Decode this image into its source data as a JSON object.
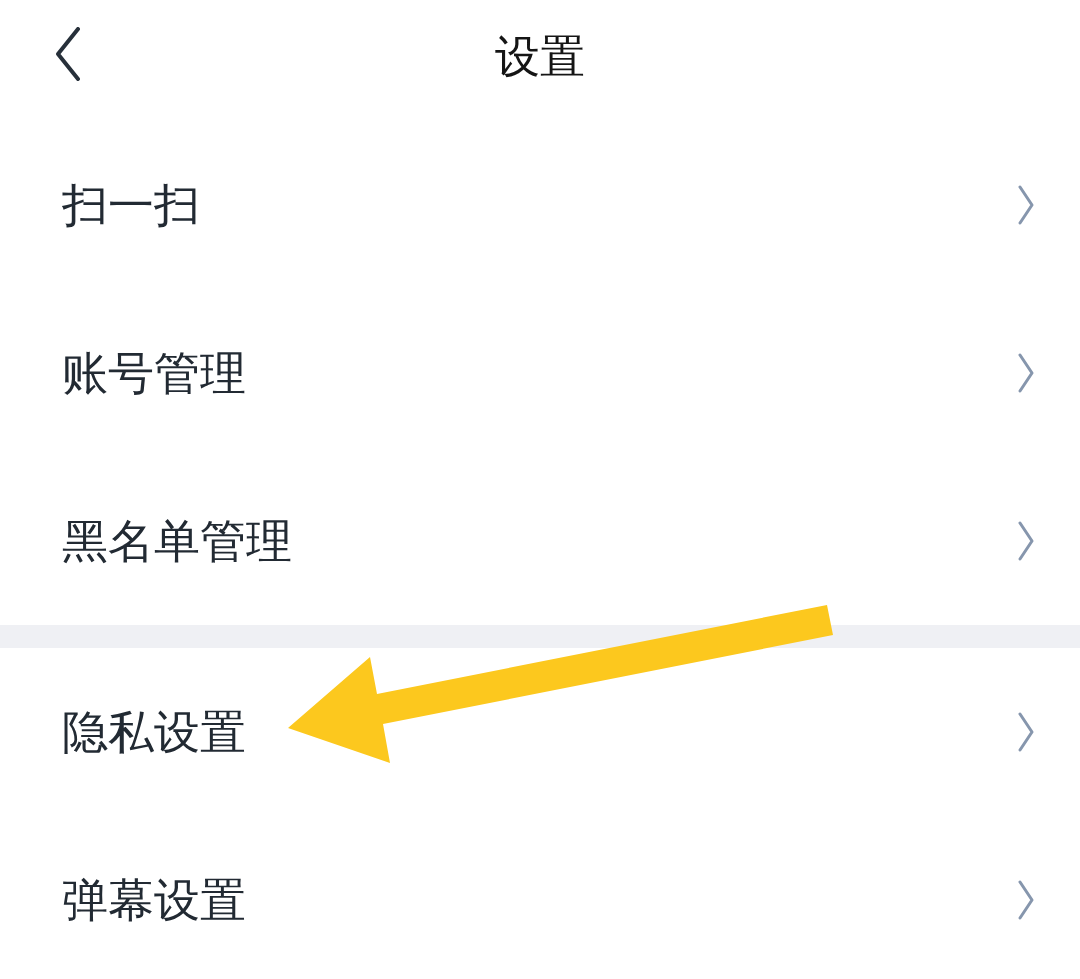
{
  "header": {
    "back": {
      "kind": "chevron"
    },
    "title": "设置"
  },
  "sections": [
    {
      "items": [
        {
          "label": "扫一扫"
        },
        {
          "label": "账号管理"
        },
        {
          "label": "黑名单管理"
        }
      ]
    },
    {
      "items": [
        {
          "label": "隐私设置"
        },
        {
          "label": "弹幕设置"
        }
      ]
    }
  ],
  "annotation": {
    "kind": "arrow"
  }
}
